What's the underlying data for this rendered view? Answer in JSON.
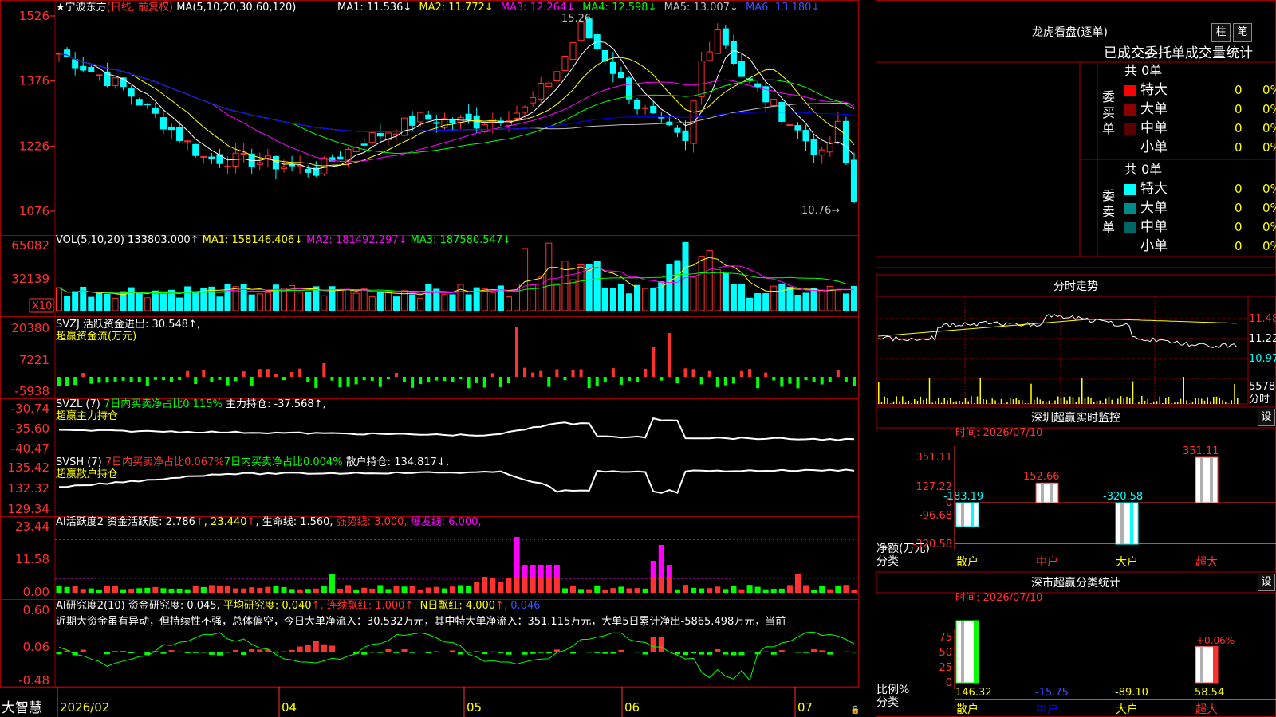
{
  "chart_data": [
    {
      "type": "candlestick",
      "title": "宁波东方",
      "mode": "(日线, 前复权)",
      "ma_label": "MA(5,10,20,30,60,120)",
      "ma_values": [
        {
          "name": "MA1",
          "value": "11.536",
          "color": "#ffffff"
        },
        {
          "name": "MA2",
          "value": "11.772",
          "color": "#ffff00"
        },
        {
          "name": "MA3",
          "value": "12.264",
          "color": "#ff00ff"
        },
        {
          "name": "MA4",
          "value": "12.598",
          "color": "#00ff00"
        },
        {
          "name": "MA5",
          "value": "13.007",
          "color": "#c0c0c0"
        },
        {
          "name": "MA6",
          "value": "13.180",
          "color": "#0000ff"
        }
      ],
      "y_ticks": [
        "1526",
        "1376",
        "1226",
        "1076"
      ],
      "x_ticks": [
        "2026/02",
        "04",
        "05",
        "06",
        "07"
      ],
      "annotations": [
        "15.26",
        "10.76"
      ],
      "ylim": [
        10.76,
        15.26
      ]
    },
    {
      "type": "bar",
      "label": "VOL(5,10,20)",
      "value": "133803.000",
      "ma": [
        {
          "name": "MA1",
          "value": "158146.406",
          "color": "#ffff00"
        },
        {
          "name": "MA2",
          "value": "181492.297",
          "color": "#ff00ff"
        },
        {
          "name": "MA3",
          "value": "187580.547",
          "color": "#00ff00"
        }
      ],
      "y_ticks": [
        "65082",
        "32139"
      ],
      "unit": "X10"
    },
    {
      "type": "bar",
      "label": "SVZJ",
      "desc": "活跃资金进出:",
      "value": "30.548",
      "subtitle": "超赢资金流(万元)",
      "y_ticks": [
        "20380",
        "7221",
        "-5938"
      ]
    },
    {
      "type": "line",
      "label": "SVZL (7)",
      "desc": "7日内买卖净占比0.115%",
      "desc2": "主力持仓:",
      "value": "-37.568",
      "subtitle": "超赢主力持仓",
      "y_ticks": [
        "-30.74",
        "-35.60",
        "-40.47"
      ]
    },
    {
      "type": "line",
      "label": "SVSH (7)",
      "desc": "7日内买卖净占比0.067%",
      "desc2": "7日内买卖净占比0.004%",
      "desc3": "散户持仓:",
      "value": "134.817",
      "subtitle": "超赢散户持仓",
      "y_ticks": [
        "135.42",
        "132.32",
        "129.34"
      ]
    },
    {
      "type": "bar",
      "label": "AI活跃度2",
      "desc": "资金活跃度:",
      "value": "2.786",
      "v2": "23.440",
      "life_label": "生命线:",
      "life": "1.560",
      "strong": "强势线: 3.000,",
      "burst": "爆发线: 6.000,",
      "y_ticks": [
        "23.44",
        "11.58",
        "0.00"
      ]
    },
    {
      "type": "bar",
      "label": "AI研究度2(10)",
      "desc": "资金研究度:",
      "value": "0.045",
      "avg": "平均研究度: 0.040",
      "red": "连续飘红: 1.000",
      "nred": "N日飘红: 4.000",
      "last": "0.046",
      "comment": "近期大资金虽有异动，但持续性不强，总体偏空，今日大单净流入：30.532万元，其中特大单净流入：351.115万元，大单5日累计净出-5865.498万元，当前",
      "y_ticks": [
        "0.60",
        "0.06",
        "-0.48"
      ]
    },
    {
      "type": "line",
      "label": "分时走势",
      "y_ticks": [
        "11.48",
        "11.22",
        "10.97",
        "5578"
      ],
      "vol_label": "分时"
    },
    {
      "type": "bar",
      "title": "深圳超赢实时监控",
      "time": "时间: 2026/07/10",
      "y_ticks": [
        "351.11",
        "127.22",
        "0",
        "-96.68",
        "-320.58"
      ],
      "categories": [
        "散户",
        "中户",
        "大户",
        "超大"
      ],
      "values": [
        -183.19,
        152.66,
        -320.58,
        351.11
      ],
      "labels": [
        "-183.19",
        "152.66",
        "-320.58",
        "351.11"
      ],
      "ylabel": "净额(万元)",
      "xlabel": "分类"
    },
    {
      "type": "bar",
      "title": "深市超赢分类统计",
      "time": "时间: 2026/07/10",
      "y_ticks": [
        "75",
        "50",
        "25",
        "0"
      ],
      "categories": [
        "散户",
        "中户",
        "大户",
        "超大"
      ],
      "values": [
        146.32,
        -15.75,
        -89.1,
        58.54
      ],
      "labels": [
        "146.32",
        "-15.75",
        "-89.10",
        "58.54"
      ],
      "extra": "+0.06%",
      "ylabel": "比例%",
      "xlabel": "分类"
    }
  ],
  "app": {
    "logo": "大智慧"
  },
  "dragon": {
    "title": "龙虎看盘(逐单)",
    "btn1": "柱",
    "btn2": "笔",
    "header": "已成交委托单成交量统计",
    "buy_label": "委买单",
    "sell_label": "委卖单",
    "buy_total": "共 0单",
    "sell_total": "共 0单",
    "rows": [
      "特大",
      "大单",
      "中单",
      "小单"
    ],
    "zero": "0",
    "pct": "0%"
  },
  "buttons": {
    "set1": "设",
    "set2": "设"
  }
}
